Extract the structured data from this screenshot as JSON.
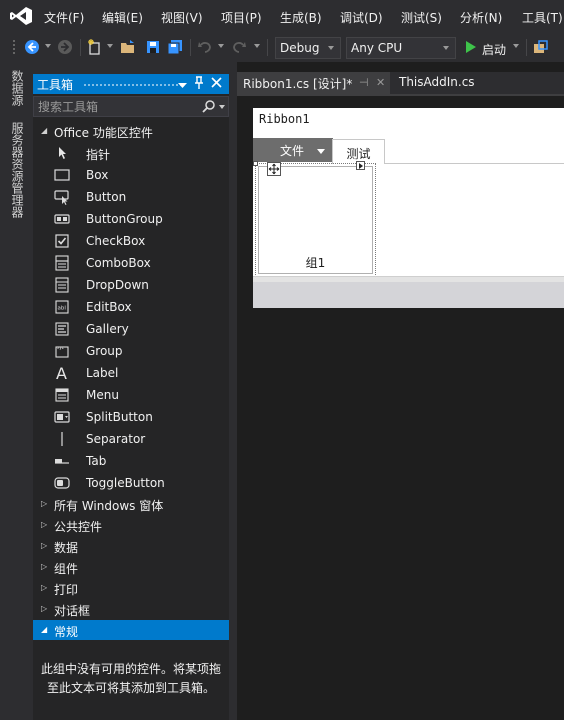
{
  "menu": {
    "items": [
      "文件(F)",
      "编辑(E)",
      "视图(V)",
      "项目(P)",
      "生成(B)",
      "调试(D)",
      "测试(S)",
      "分析(N)",
      "工具(T)"
    ]
  },
  "toolbar": {
    "config_value": "Debug",
    "platform_value": "Any CPU",
    "start_label": "启动"
  },
  "side_tabs": {
    "data_sources": "数据源",
    "server_explorer": "服务器资源管理器"
  },
  "toolbox": {
    "title": "工具箱",
    "search_placeholder": "搜索工具箱",
    "office_group": "Office 功能区控件",
    "tools": [
      {
        "label": "指针",
        "icon": "pointer-icon"
      },
      {
        "label": "Box",
        "icon": "box-icon"
      },
      {
        "label": "Button",
        "icon": "button-icon"
      },
      {
        "label": "ButtonGroup",
        "icon": "buttongroup-icon"
      },
      {
        "label": "CheckBox",
        "icon": "checkbox-icon"
      },
      {
        "label": "ComboBox",
        "icon": "combobox-icon"
      },
      {
        "label": "DropDown",
        "icon": "dropdown-icon"
      },
      {
        "label": "EditBox",
        "icon": "editbox-icon"
      },
      {
        "label": "Gallery",
        "icon": "gallery-icon"
      },
      {
        "label": "Group",
        "icon": "group-icon"
      },
      {
        "label": "Label",
        "icon": "label-icon"
      },
      {
        "label": "Menu",
        "icon": "menu-icon"
      },
      {
        "label": "SplitButton",
        "icon": "splitbutton-icon"
      },
      {
        "label": "Separator",
        "icon": "separator-icon"
      },
      {
        "label": "Tab",
        "icon": "tab-icon"
      },
      {
        "label": "ToggleButton",
        "icon": "togglebutton-icon"
      }
    ],
    "groups": [
      "所有 Windows 窗体",
      "公共控件",
      "数据",
      "组件",
      "打印",
      "对话框"
    ],
    "general_group": "常规",
    "empty_message": "此组中没有可用的控件。将某项拖至此文本可将其添加到工具箱。"
  },
  "tabs": {
    "active": "Ribbon1.cs [设计]*",
    "inactive": "ThisAddIn.cs"
  },
  "designer": {
    "ribbon_name": "Ribbon1",
    "file_tab": "文件",
    "ribbon_tab": "测试",
    "group_label": "组1"
  },
  "colors": {
    "accent": "#007acc",
    "background": "#2d2d30",
    "panel": "#252526"
  }
}
